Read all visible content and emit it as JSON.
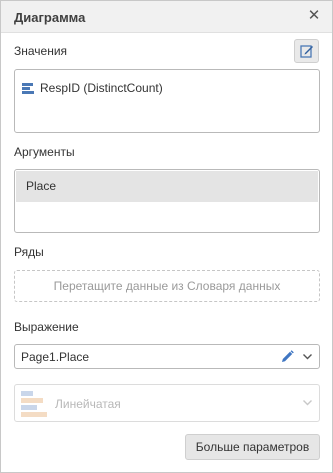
{
  "window": {
    "title": "Диаграмма"
  },
  "values": {
    "label": "Значения",
    "items": [
      {
        "text": "RespID (DistinctCount)",
        "icon": "bar-chart-icon"
      }
    ]
  },
  "arguments": {
    "label": "Аргументы",
    "items": [
      {
        "text": "Place"
      }
    ]
  },
  "series": {
    "label": "Ряды",
    "placeholder": "Перетащите данные из Словаря данных"
  },
  "expression": {
    "label": "Выражение",
    "value": "Page1.Place"
  },
  "chart_type": {
    "value": "Линейчатая",
    "disabled": true
  },
  "buttons": {
    "more_params": "Больше параметров"
  },
  "colors": {
    "accent": "#4a78b5",
    "header_bg": "#f1f1f1",
    "selected_item_bg": "#e4e4e4"
  }
}
